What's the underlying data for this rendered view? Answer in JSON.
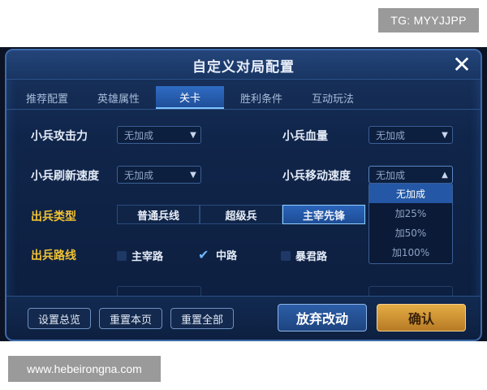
{
  "watermarks": {
    "top": "TG: MYYJJPP",
    "bottom": "www.hebeirongna.com"
  },
  "dialog": {
    "title": "自定义对局配置"
  },
  "tabs": [
    {
      "label": "推荐配置",
      "active": false
    },
    {
      "label": "英雄属性",
      "active": false
    },
    {
      "label": "关卡",
      "active": true
    },
    {
      "label": "胜利条件",
      "active": false
    },
    {
      "label": "互动玩法",
      "active": false
    }
  ],
  "settings": {
    "minion_attack": {
      "label": "小兵攻击力",
      "value": "无加成"
    },
    "minion_hp": {
      "label": "小兵血量",
      "value": "无加成"
    },
    "minion_refresh": {
      "label": "小兵刷新速度",
      "value": "无加成"
    },
    "minion_move": {
      "label": "小兵移动速度",
      "value": "无加成"
    }
  },
  "move_speed_options": [
    "无加成",
    "加25%",
    "加50%",
    "加100%"
  ],
  "minion_type": {
    "label": "出兵类型",
    "options": [
      "普通兵线",
      "超级兵",
      "主宰先锋"
    ],
    "selected": "主宰先锋"
  },
  "minion_lane": {
    "label": "出兵路线",
    "options": [
      {
        "label": "主宰路",
        "checked": false
      },
      {
        "label": "中路",
        "checked": true
      },
      {
        "label": "暴君路",
        "checked": false
      }
    ]
  },
  "footer": {
    "overview": "设置总览",
    "reset_page": "重置本页",
    "reset_all": "重置全部",
    "discard": "放弃改动",
    "confirm": "确认"
  },
  "colors": {
    "accent": "#2f6cc4",
    "gold_label": "#f1c232",
    "confirm": "#e4ad45"
  }
}
